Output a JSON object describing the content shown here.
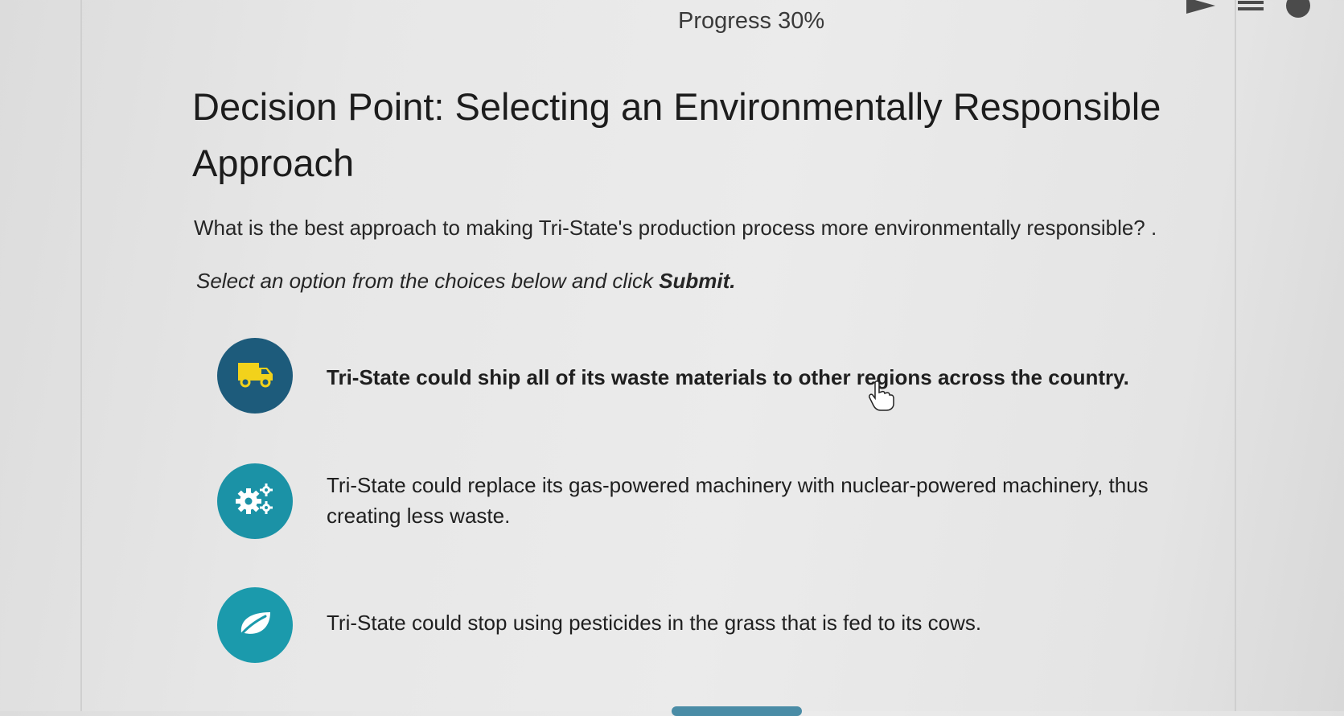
{
  "header": {
    "progress_label": "Progress 30%",
    "progress_value": 30
  },
  "title": "Decision Point: Selecting an Environmentally Responsible Approach",
  "question": "What is the best approach to making Tri-State's production process more environmentally responsible? .",
  "instruction": {
    "prefix": "Select an option from the choices below and click ",
    "action": "Submit."
  },
  "options": [
    {
      "text": "Tri-State could ship all of its waste materials to other regions across the country.",
      "icon": "truck-icon",
      "color": "#1d5b7b"
    },
    {
      "text": "Tri-State could replace its gas-powered machinery with nuclear-powered machinery, thus creating less waste.",
      "icon": "gears-icon",
      "color": "#1b92a6"
    },
    {
      "text": "Tri-State could stop using pesticides in the grass that is fed to its cows.",
      "icon": "leaf-icon",
      "color": "#1b9aac"
    }
  ],
  "colors": {
    "background": "#e8e8e8",
    "text": "#1c1c1c",
    "icon_accent": "#f2d21b",
    "submit": "#4a8ca6"
  }
}
